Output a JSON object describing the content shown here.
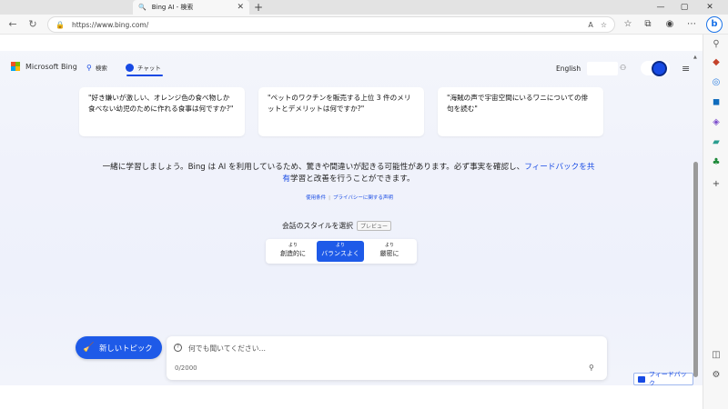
{
  "browser": {
    "tab_title": "Bing AI - 検索",
    "tab_close": "✕",
    "new_tab": "+",
    "url": "https://www.bing.com/",
    "window": {
      "minimize": "—",
      "restore": "▢",
      "close": "✕"
    }
  },
  "bing": {
    "brand": "Microsoft Bing",
    "nav_search": "検索",
    "nav_chat": "チャット",
    "language": "English"
  },
  "suggestions": [
    {
      "text": "\"好き嫌いが激しい、オレンジ色の食べ物しか食べない幼児のために作れる食事は何ですか?\""
    },
    {
      "text": "\"ペットのワクチンを販売する上位 3 件のメリットとデメリットは何ですか?\""
    },
    {
      "text": "\"海賊の声で宇宙空間にいるワニについての俳句を読む\""
    }
  ],
  "disclaimer": {
    "before": "一緒に学習しましょう。Bing は AI を利用しているため、驚きや間違いが起きる可能性があります。必ず事実を確認し、",
    "link": "フィードバックを共有",
    "after": "学習と改善を行うことができます。"
  },
  "links": {
    "terms": "使用条件",
    "privacy": "プライバシーに関する声明"
  },
  "style": {
    "label": "会話のスタイルを選択",
    "badge": "プレビュー",
    "options": [
      {
        "small": "より",
        "main": "創造的に"
      },
      {
        "small": "より",
        "main": "バランスよく"
      },
      {
        "small": "より",
        "main": "厳密に"
      }
    ],
    "selected": "バランスよく"
  },
  "chat": {
    "new_topic": "新しいトピック",
    "placeholder": "何でも聞いてください...",
    "counter": "0/2000"
  },
  "feedback": "フィードバック",
  "colors": {
    "accent": "#1e5ae8",
    "link": "#174ae4"
  }
}
